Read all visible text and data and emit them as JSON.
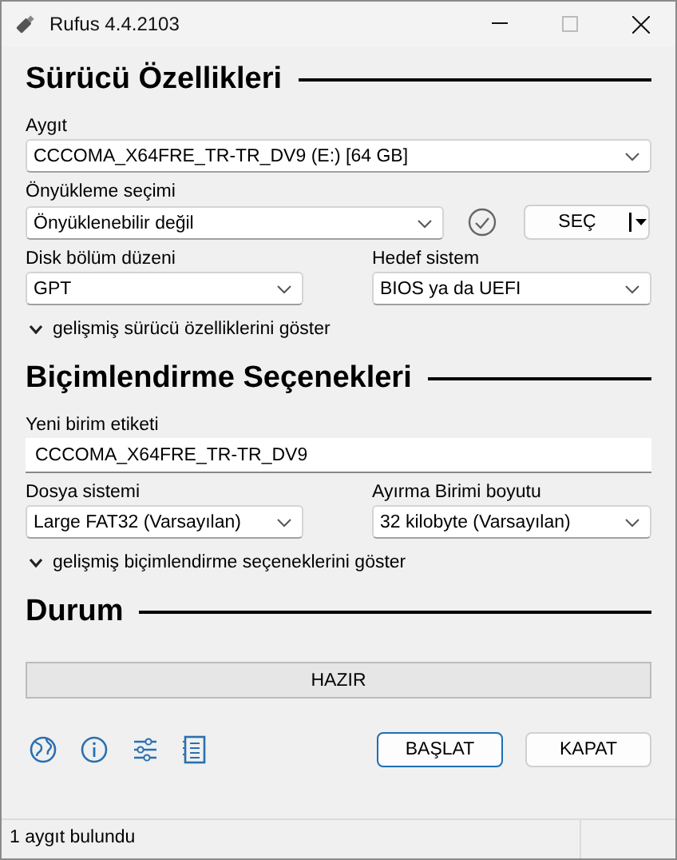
{
  "window": {
    "title": "Rufus 4.4.2103"
  },
  "drive_section": {
    "title": "Sürücü Özellikleri",
    "device": {
      "label": "Aygıt",
      "value": "CCCOMA_X64FRE_TR-TR_DV9 (E:) [64 GB]"
    },
    "boot_selection": {
      "label": "Önyükleme seçimi",
      "value": "Önyüklenebilir değil",
      "select_button": "SEÇ"
    },
    "partition_scheme": {
      "label": "Disk bölüm düzeni",
      "value": "GPT"
    },
    "target_system": {
      "label": "Hedef sistem",
      "value": "BIOS ya da UEFI"
    },
    "advanced_toggle": {
      "label": "gelişmiş sürücü özelliklerini göster",
      "expanded": false
    }
  },
  "format_section": {
    "title": "Biçimlendirme Seçenekleri",
    "volume_label": {
      "label": "Yeni birim etiketi",
      "value": "CCCOMA_X64FRE_TR-TR_DV9"
    },
    "file_system": {
      "label": "Dosya sistemi",
      "value": "Large FAT32 (Varsayılan)"
    },
    "cluster_size": {
      "label": "Ayırma Birimi boyutu",
      "value": "32 kilobyte (Varsayılan)"
    },
    "advanced_toggle": {
      "label": "gelişmiş biçimlendirme seçeneklerini göster",
      "expanded": false
    }
  },
  "status_section": {
    "title": "Durum",
    "progress": {
      "text": "HAZIR",
      "level": 0
    }
  },
  "buttons": [
    {
      "label": "BAŞLAT",
      "selected": true
    },
    {
      "label": "KAPAT",
      "selected": false
    }
  ],
  "status_bar": {
    "text": "1 aygıt bulundu"
  }
}
